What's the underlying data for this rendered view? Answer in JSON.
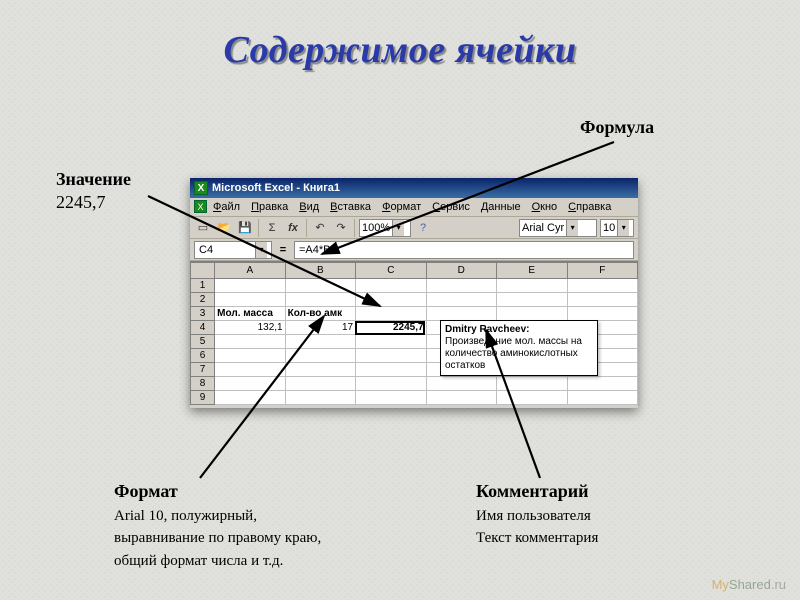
{
  "slide": {
    "title": "Содержимое ячейки"
  },
  "annotations": {
    "formula": {
      "label": "Формула"
    },
    "value": {
      "label": "Значение",
      "text": "2245,7"
    },
    "format": {
      "label": "Формат",
      "line1": "Arial 10, полужирный,",
      "line2": " выравнивание по правому краю,",
      "line3": "общий формат числа и т.д."
    },
    "comment": {
      "label": "Комментарий",
      "line1": "Имя пользователя",
      "line2": "Текст комментария"
    }
  },
  "excel": {
    "app_title": "Microsoft Excel - Книга1",
    "menus": [
      "Файл",
      "Правка",
      "Вид",
      "Вставка",
      "Формат",
      "Сервис",
      "Данные",
      "Окно",
      "Справка"
    ],
    "toolbar": {
      "zoom": "100%",
      "font": "Arial Cyr",
      "font_size": "10",
      "icons": {
        "new": "new-doc-icon",
        "open": "open-icon",
        "save": "save-icon",
        "print": "print-icon",
        "sum": "sum-icon",
        "fx": "fx-icon",
        "undo": "undo-icon",
        "redo": "redo-icon",
        "help": "help-icon"
      }
    },
    "formulabar": {
      "name_box": "C4",
      "formula": "=A4*B4"
    },
    "columns": [
      "A",
      "B",
      "C",
      "D",
      "E",
      "F"
    ],
    "rows": [
      "1",
      "2",
      "3",
      "4",
      "5",
      "6",
      "7",
      "8",
      "9"
    ],
    "headers_row3": {
      "A": "Мол. масса",
      "B": "Кол-во амк"
    },
    "values_row4": {
      "A": "132,1",
      "B": "17",
      "C": "2245,7"
    },
    "comment_tip": {
      "author": "Dmitry Ravcheev:",
      "body": "Произведение мол. массы на количество аминокислотных остатков"
    }
  },
  "watermark": {
    "my": "My",
    "shared": "Shared",
    "ru": ".ru"
  }
}
